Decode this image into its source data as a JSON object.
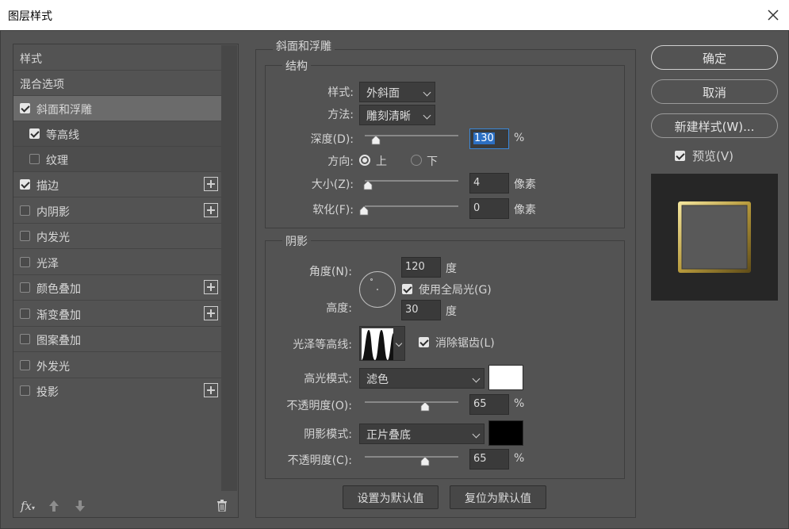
{
  "window": {
    "title": "图层样式"
  },
  "left_list": {
    "items": [
      {
        "label": "样式",
        "checkbox": null,
        "plus": false,
        "state": "normal"
      },
      {
        "label": "混合选项",
        "checkbox": null,
        "plus": false,
        "state": "normal"
      },
      {
        "label": "斜面和浮雕",
        "checkbox": true,
        "plus": false,
        "state": "selected"
      },
      {
        "label": "等高线",
        "checkbox": true,
        "plus": false,
        "state": "sub"
      },
      {
        "label": "纹理",
        "checkbox": false,
        "plus": false,
        "state": "sub"
      },
      {
        "label": "描边",
        "checkbox": true,
        "plus": true,
        "state": "normal"
      },
      {
        "label": "内阴影",
        "checkbox": false,
        "plus": true,
        "state": "normal"
      },
      {
        "label": "内发光",
        "checkbox": false,
        "plus": false,
        "state": "normal"
      },
      {
        "label": "光泽",
        "checkbox": false,
        "plus": false,
        "state": "normal"
      },
      {
        "label": "颜色叠加",
        "checkbox": false,
        "plus": true,
        "state": "normal"
      },
      {
        "label": "渐变叠加",
        "checkbox": false,
        "plus": true,
        "state": "normal"
      },
      {
        "label": "图案叠加",
        "checkbox": false,
        "plus": false,
        "state": "normal"
      },
      {
        "label": "外发光",
        "checkbox": false,
        "plus": false,
        "state": "normal"
      },
      {
        "label": "投影",
        "checkbox": false,
        "plus": true,
        "state": "normal"
      }
    ],
    "footer": {
      "fx_label": "fx",
      "icons": [
        "move-up-icon",
        "move-down-icon",
        "trash-icon"
      ]
    }
  },
  "bevel": {
    "section_title": "斜面和浮雕",
    "structure": {
      "title": "结构",
      "style_label": "样式:",
      "style_value": "外斜面",
      "technique_label": "方法:",
      "technique_value": "雕刻清晰",
      "depth_label": "深度(D):",
      "depth_value": "130",
      "depth_unit": "%",
      "direction_label": "方向:",
      "direction_up": "上",
      "direction_down": "下",
      "direction_selected": "up",
      "size_label": "大小(Z):",
      "size_value": "4",
      "size_unit": "像素",
      "soften_label": "软化(F):",
      "soften_value": "0",
      "soften_unit": "像素"
    },
    "shading": {
      "title": "阴影",
      "angle_label": "角度(N):",
      "angle_value": "120",
      "angle_unit": "度",
      "global_light_label": "使用全局光(G)",
      "global_light_checked": true,
      "altitude_label": "高度:",
      "altitude_value": "30",
      "altitude_unit": "度",
      "gloss_contour_label": "光泽等高线:",
      "antialias_label": "消除锯齿(L)",
      "antialias_checked": true,
      "highlight_mode_label": "高光模式:",
      "highlight_mode_value": "滤色",
      "highlight_color": "#ffffff",
      "highlight_opacity_label": "不透明度(O):",
      "highlight_opacity_value": "65",
      "highlight_opacity_unit": "%",
      "shadow_mode_label": "阴影模式:",
      "shadow_mode_value": "正片叠底",
      "shadow_color": "#000000",
      "shadow_opacity_label": "不透明度(C):",
      "shadow_opacity_value": "65",
      "shadow_opacity_unit": "%"
    },
    "make_default_label": "设置为默认值",
    "reset_default_label": "复位为默认值"
  },
  "right": {
    "ok_label": "确定",
    "cancel_label": "取消",
    "new_style_label": "新建样式(W)...",
    "preview_label": "预览(V)",
    "preview_checked": true
  },
  "colors": {
    "panel": "#535353",
    "frame_gold": "#c9b25a"
  }
}
